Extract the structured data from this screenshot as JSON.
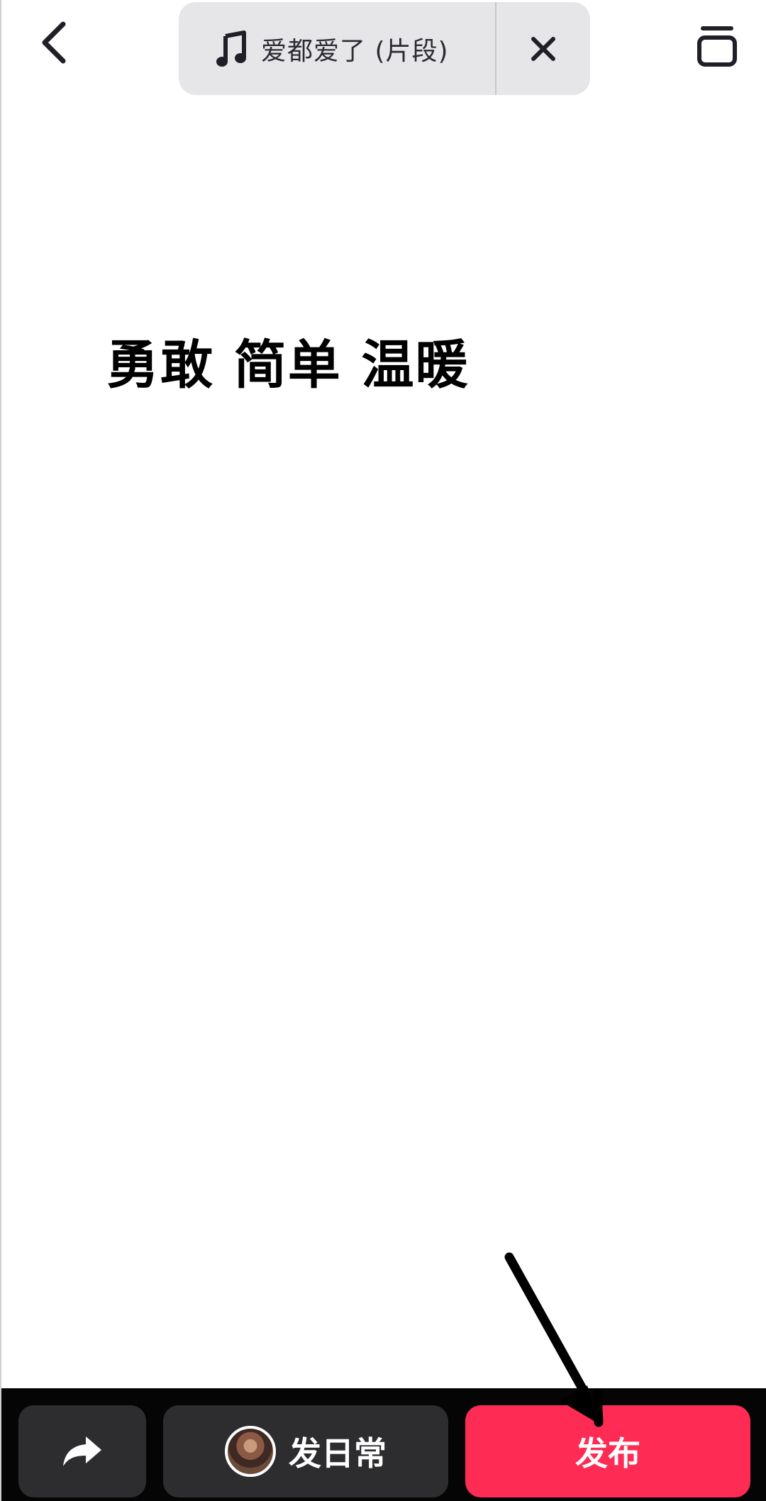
{
  "topbar": {
    "back_icon": "chevron-left-icon",
    "music": {
      "icon": "music-note-icon",
      "title": "爱都爱了 (片段)",
      "close_icon": "close-icon"
    },
    "trash_icon": "trash-icon"
  },
  "content": {
    "caption": "勇敢 简单 温暖"
  },
  "bottom": {
    "share_icon": "share-arrow-icon",
    "daily_label": "发日常",
    "publish_label": "发布",
    "publish_color": "#fe2c55"
  },
  "annotation": {
    "arrow_icon": "pointer-arrow-icon"
  }
}
